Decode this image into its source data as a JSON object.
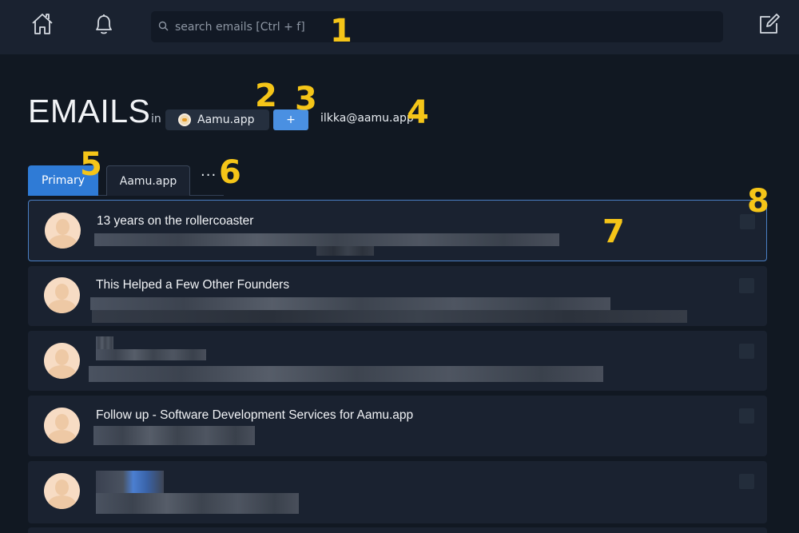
{
  "topbar": {
    "search": {
      "placeholder": "search emails [Ctrl + f]",
      "value": ""
    },
    "icons": [
      "home-icon",
      "bell-icon",
      "compose-icon",
      "search-icon"
    ]
  },
  "header": {
    "title": "EMAILS",
    "in_label": "in",
    "org": "Aamu.app",
    "add_label": "+",
    "account": "ilkka@aamu.app"
  },
  "tabs": [
    {
      "label": "Primary",
      "active": true
    },
    {
      "label": "Aamu.app",
      "active": false
    }
  ],
  "more_tabs_label": "···",
  "emails": [
    {
      "subject": "13 years on the rollercoaster",
      "selected": true
    },
    {
      "subject": "This Helped a Few Other Founders",
      "selected": false
    },
    {
      "subject": "",
      "selected": false
    },
    {
      "subject": "Follow up - Software Development Services for Aamu.app",
      "selected": false
    },
    {
      "subject": "",
      "selected": false
    }
  ],
  "annotations": [
    "1",
    "2",
    "3",
    "4",
    "5",
    "6",
    "7",
    "8"
  ],
  "colors": {
    "accent": "#4a90e2",
    "active_tab": "#2f7bd6",
    "background": "#111822",
    "panel": "#1a2230",
    "annotation": "#f5c518"
  }
}
